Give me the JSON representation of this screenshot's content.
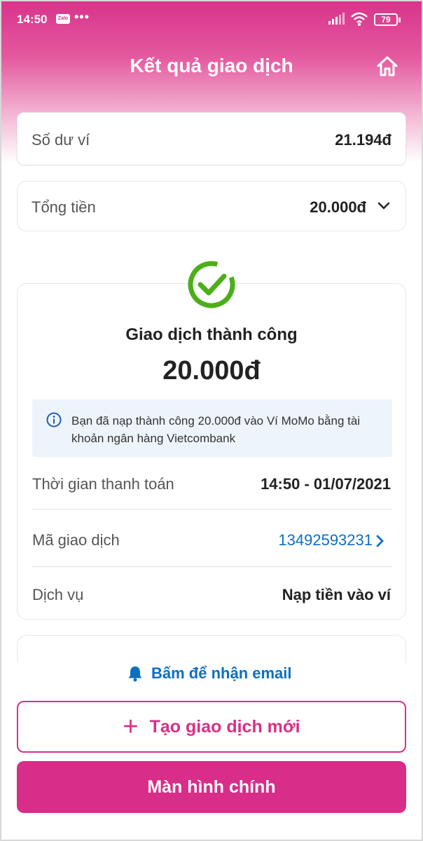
{
  "status_bar": {
    "time": "14:50",
    "notification_app": "Zalo",
    "more": "•••",
    "battery": "79"
  },
  "header": {
    "title": "Kết quả giao dịch"
  },
  "balance": {
    "label": "Số dư ví",
    "value": "21.194đ"
  },
  "total": {
    "label": "Tổng tiền",
    "value": "20.000đ"
  },
  "result": {
    "title": "Giao dịch thành công",
    "amount": "20.000đ",
    "info": "Bạn đã nạp thành công 20.000đ vào Ví MoMo bằng tài khoản ngân hàng Vietcombank",
    "rows": [
      {
        "label": "Thời gian thanh toán",
        "value": "14:50 - 01/07/2021"
      },
      {
        "label": "Mã giao dịch",
        "value": "13492593231"
      },
      {
        "label": "Dịch vụ",
        "value": "Nạp tiền vào ví"
      }
    ]
  },
  "email_link": "Bấm để nhận email",
  "buttons": {
    "new_transaction": "Tạo giao dịch mới",
    "home_screen": "Màn hình chính"
  },
  "colors": {
    "brand": "#d82d88",
    "link": "#0b6fc4",
    "success": "#4caf1a"
  }
}
